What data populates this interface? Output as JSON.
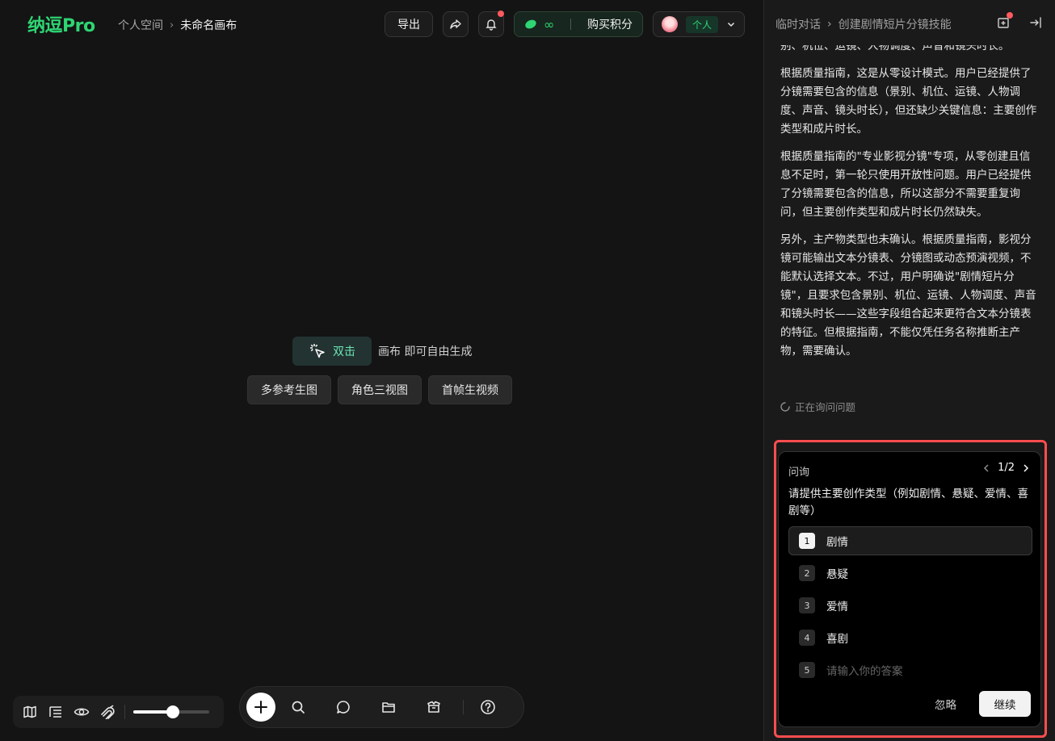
{
  "header": {
    "logo": "纳逗Pro",
    "breadcrumb": {
      "space": "个人空间",
      "separator": "›",
      "canvas": "未命名画布"
    },
    "export_label": "导出",
    "points_value": "∞",
    "buy_points_label": "购买积分",
    "account_badge": "个人"
  },
  "canvas": {
    "double_click_label": "双击",
    "hint_text": "画布 即可自由生成",
    "quick_actions": [
      "多参考生图",
      "角色三视图",
      "首帧生视频"
    ]
  },
  "zoom": {
    "level": 0.52
  },
  "panel": {
    "conversation_label": "临时对话",
    "separator": "›",
    "conversation_title": "创建剧情短片分镜技能",
    "messages": [
      "别、机位、运镜、人物调度、声音和镜头时长。",
      "根据质量指南，这是从零设计模式。用户已经提供了分镜需要包含的信息（景别、机位、运镜、人物调度、声音、镜头时长），但还缺少关键信息：主要创作类型和成片时长。",
      "根据质量指南的\"专业影视分镜\"专项，从零创建且信息不足时，第一轮只使用开放性问题。用户已经提供了分镜需要包含的信息，所以这部分不需要重复询问，但主要创作类型和成片时长仍然缺失。",
      "另外，主产物类型也未确认。根据质量指南，影视分镜可能输出文本分镜表、分镜图或动态预演视频，不能默认选择文本。不过，用户明确说\"剧情短片分镜\"，且要求包含景别、机位、运镜、人物调度、声音和镜头时长——这些字段组合起来更符合文本分镜表的特征。但根据指南，不能仅凭任务名称推断主产物，需要确认。"
    ],
    "status_text": "正在询问问题"
  },
  "ask": {
    "title": "问询",
    "page": "1/2",
    "question": "请提供主要创作类型（例如剧情、悬疑、爱情、喜剧等）",
    "options": [
      {
        "num": "1",
        "label": "剧情"
      },
      {
        "num": "2",
        "label": "悬疑"
      },
      {
        "num": "3",
        "label": "爱情"
      },
      {
        "num": "4",
        "label": "喜剧"
      }
    ],
    "custom_num": "5",
    "custom_placeholder": "请输入你的答案",
    "ignore_label": "忽略",
    "continue_label": "继续"
  },
  "colors": {
    "brand": "#2ed573",
    "highlight_border": "#ff4d4f",
    "notification_dot": "#ff5a5f"
  }
}
